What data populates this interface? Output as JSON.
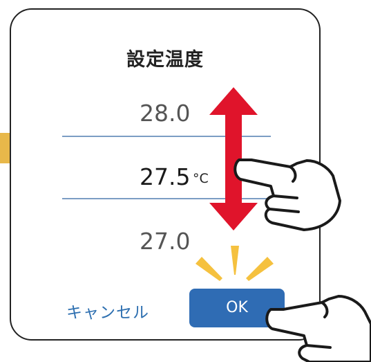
{
  "dialog": {
    "title": "設定温度",
    "picker": {
      "previous_value": "28.0",
      "current_value": "27.5",
      "unit": "°C",
      "next_value": "27.0"
    },
    "cancel_label": "キャンセル",
    "ok_label": "OK"
  },
  "colors": {
    "accent_blue": "#2f6cb4",
    "link_blue": "#2d6fb0",
    "arrow_red": "#e0142b",
    "pointer_arrow_yellow": "#e8b84a",
    "highlight_yellow": "#f5c13f"
  },
  "annotations": {
    "left_pointer": "arrow-right-icon",
    "scroll_indicator": "double-arrow-vertical-icon",
    "gesture_swipe": "pointing-hand-icon",
    "gesture_tap": "pointing-hand-icon",
    "tap_highlight": "tap-burst-icon"
  }
}
